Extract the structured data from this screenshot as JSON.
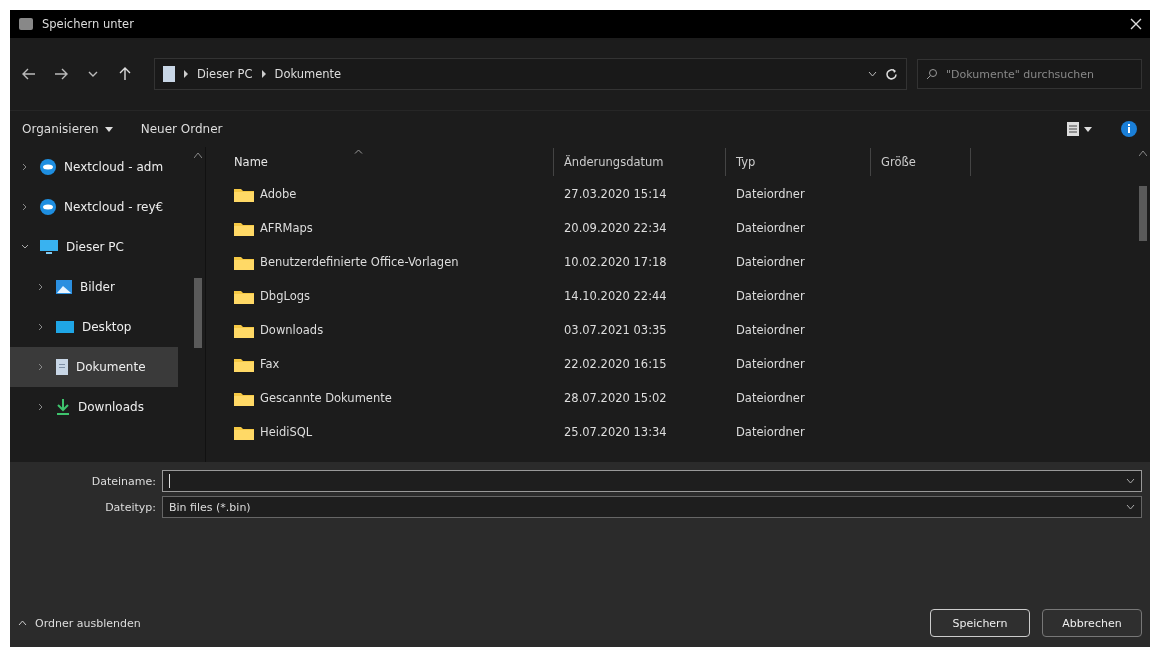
{
  "window": {
    "title": "Speichern unter"
  },
  "address": {
    "breadcrumb": [
      "Dieser PC",
      "Dokumente"
    ]
  },
  "search": {
    "placeholder": "\"Dokumente\" durchsuchen"
  },
  "toolbar": {
    "organize": "Organisieren",
    "new_folder": "Neuer Ordner"
  },
  "sidebar": {
    "items": [
      {
        "label": "Nextcloud - adm",
        "kind": "cloud",
        "expanded": false,
        "selected": false
      },
      {
        "label": "Nextcloud - rey€",
        "kind": "cloud",
        "expanded": false,
        "selected": false
      },
      {
        "label": "Dieser PC",
        "kind": "pc",
        "expanded": true,
        "selected": false,
        "children": [
          {
            "label": "Bilder",
            "kind": "pictures",
            "expanded": false,
            "selected": false
          },
          {
            "label": "Desktop",
            "kind": "desktop",
            "expanded": false,
            "selected": false
          },
          {
            "label": "Dokumente",
            "kind": "documents",
            "expanded": false,
            "selected": true
          },
          {
            "label": "Downloads",
            "kind": "downloads",
            "expanded": false,
            "selected": false
          }
        ]
      }
    ]
  },
  "table": {
    "columns": [
      {
        "label": "Name",
        "sorted": true
      },
      {
        "label": "Änderungsdatum",
        "sorted": false
      },
      {
        "label": "Typ",
        "sorted": false
      },
      {
        "label": "Größe",
        "sorted": false
      }
    ],
    "rows": [
      {
        "name": "Adobe",
        "modified": "27.03.2020 15:14",
        "type": "Dateiordner"
      },
      {
        "name": "AFRMaps",
        "modified": "20.09.2020 22:34",
        "type": "Dateiordner"
      },
      {
        "name": "Benutzerdefinierte Office-Vorlagen",
        "modified": "10.02.2020 17:18",
        "type": "Dateiordner"
      },
      {
        "name": "DbgLogs",
        "modified": "14.10.2020 22:44",
        "type": "Dateiordner"
      },
      {
        "name": "Downloads",
        "modified": "03.07.2021 03:35",
        "type": "Dateiordner"
      },
      {
        "name": "Fax",
        "modified": "22.02.2020 16:15",
        "type": "Dateiordner"
      },
      {
        "name": "Gescannte Dokumente",
        "modified": "28.07.2020 15:02",
        "type": "Dateiordner"
      },
      {
        "name": "HeidiSQL",
        "modified": "25.07.2020 13:34",
        "type": "Dateiordner"
      }
    ]
  },
  "form": {
    "filename_label": "Dateiname:",
    "filetype_label": "Dateityp:",
    "filetype_value": "Bin files (*.bin)"
  },
  "hide_folders": "Ordner ausblenden",
  "buttons": [
    {
      "label": "Speichern",
      "kind": "primary"
    },
    {
      "label": "Abbrechen",
      "kind": "secondary"
    }
  ]
}
